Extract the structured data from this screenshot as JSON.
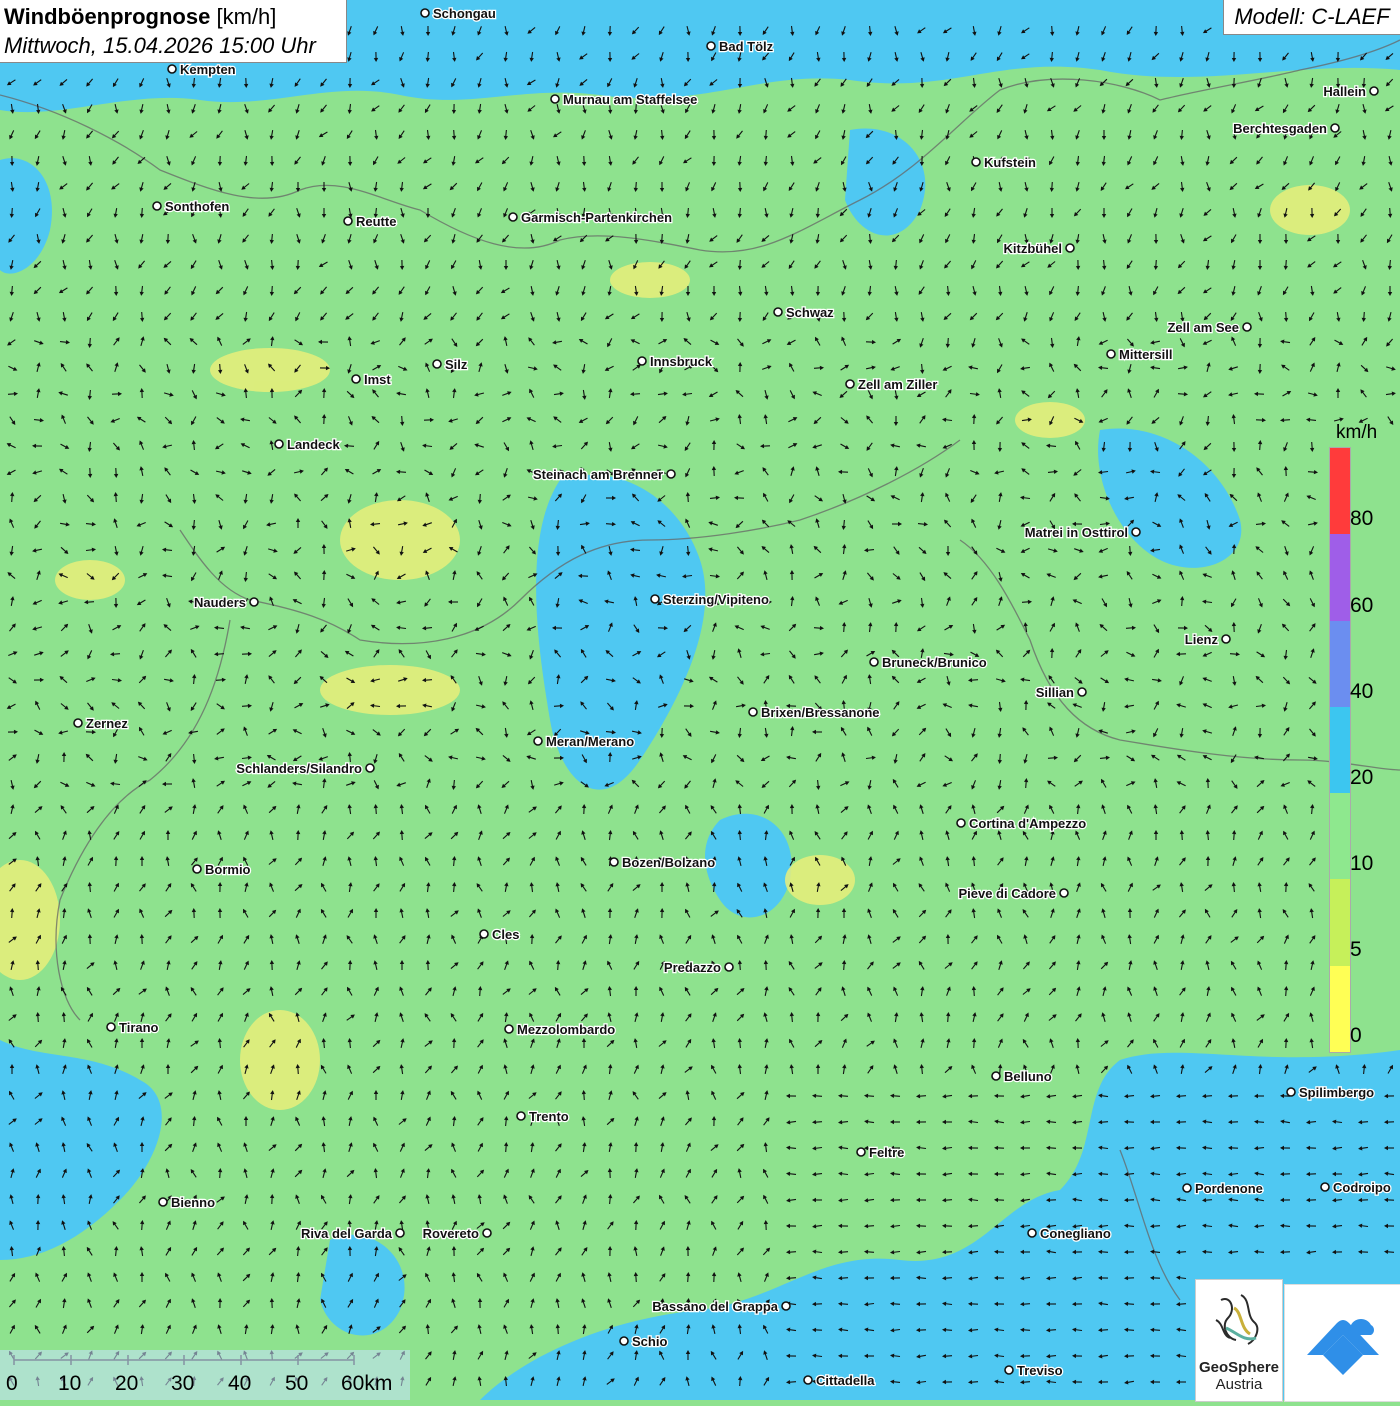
{
  "title": {
    "bold": "Windböenprognose",
    "unit": "[km/h]",
    "datetime": "Mittwoch, 15.04.2026 15:00 Uhr"
  },
  "model": "Modell: C-LAEF",
  "legend": {
    "unit": "km/h",
    "ticks": [
      "80",
      "60",
      "40",
      "20",
      "10",
      "5",
      "0"
    ],
    "colors": [
      "#ff3b3b",
      "#9f5ee8",
      "#6b8ef0",
      "#3cc6f0",
      "#8ee88e",
      "#c6f05a",
      "#ffff55"
    ]
  },
  "colors": {
    "land_green": "#8ee28e",
    "calm_blue": "#4fc8f2",
    "gust_yellow": "#e9ef7a"
  },
  "scale_labels": [
    "0",
    "10",
    "20",
    "30",
    "40",
    "50",
    "60km"
  ],
  "logos": {
    "geosphere": "GeoSphere",
    "austria": "Austria"
  },
  "map": {
    "type": "wind-gust-forecast",
    "cities": [
      {
        "name": "Schongau"
      },
      {
        "name": "Kempten"
      },
      {
        "name": "Bad Tölz"
      },
      {
        "name": "Murnau am Staffelsee"
      },
      {
        "name": "Hallein"
      },
      {
        "name": "Berchtesgaden"
      },
      {
        "name": "Kufstein"
      },
      {
        "name": "Sonthofen"
      },
      {
        "name": "Reutte"
      },
      {
        "name": "Garmisch-Partenkirchen"
      },
      {
        "name": "Kitzbühel"
      },
      {
        "name": "Schwaz"
      },
      {
        "name": "Zell am See"
      },
      {
        "name": "Mittersill"
      },
      {
        "name": "Innsbruck"
      },
      {
        "name": "Silz"
      },
      {
        "name": "Imst"
      },
      {
        "name": "Zell am Ziller"
      },
      {
        "name": "Landeck"
      },
      {
        "name": "Steinach am Brenner"
      },
      {
        "name": "Matrei in Osttirol"
      },
      {
        "name": "Nauders"
      },
      {
        "name": "Sterzing/Vipiteno"
      },
      {
        "name": "Lienz"
      },
      {
        "name": "Bruneck/Brunico"
      },
      {
        "name": "Sillian"
      },
      {
        "name": "Zernez"
      },
      {
        "name": "Brixen/Bressanone"
      },
      {
        "name": "Meran/Merano"
      },
      {
        "name": "Schlanders/Silandro"
      },
      {
        "name": "Cortina d'Ampezzo"
      },
      {
        "name": "Bozen/Bolzano"
      },
      {
        "name": "Bormio"
      },
      {
        "name": "Pieve di Cadore"
      },
      {
        "name": "Cles"
      },
      {
        "name": "Predazzo"
      },
      {
        "name": "Tirano"
      },
      {
        "name": "Mezzolombardo"
      },
      {
        "name": "Belluno"
      },
      {
        "name": "Spilimbergo"
      },
      {
        "name": "Trento"
      },
      {
        "name": "Feltre"
      },
      {
        "name": "Bienno"
      },
      {
        "name": "Pordenone"
      },
      {
        "name": "Codroipo"
      },
      {
        "name": "Riva del Garda"
      },
      {
        "name": "Rovereto"
      },
      {
        "name": "Conegliano"
      },
      {
        "name": "Bassano del Grappa"
      },
      {
        "name": "Schio"
      },
      {
        "name": "Treviso"
      },
      {
        "name": "Cittadella"
      }
    ]
  }
}
